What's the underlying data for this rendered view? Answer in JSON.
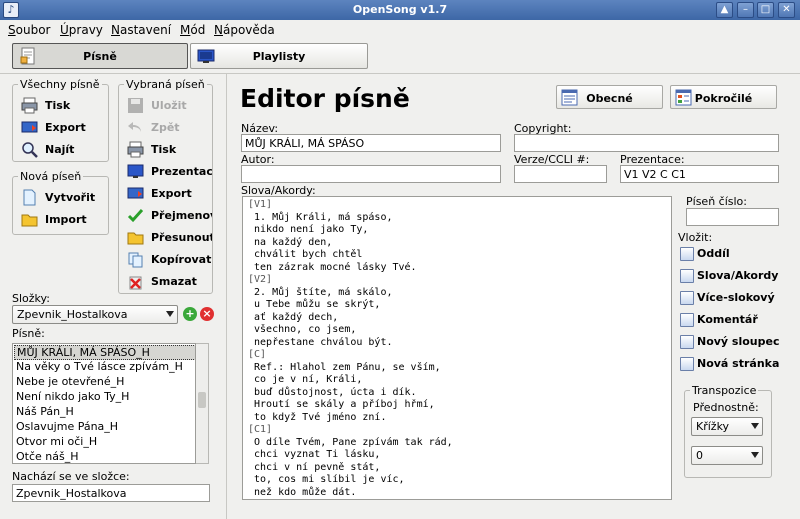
{
  "window": {
    "title": "OpenSong v1.7"
  },
  "menu": [
    "Soubor",
    "Úpravy",
    "Nastavení",
    "Mód",
    "Nápověda"
  ],
  "main_tabs": [
    {
      "label": "Písně",
      "active": true
    },
    {
      "label": "Playlisty",
      "active": false
    }
  ],
  "all_songs": {
    "title": "Všechny písně",
    "buttons": [
      "Tisk",
      "Export",
      "Najít"
    ]
  },
  "new_song": {
    "title": "Nová píseň",
    "buttons": [
      "Vytvořit",
      "Import"
    ]
  },
  "selected_song": {
    "title": "Vybraná píseň",
    "buttons": [
      {
        "label": "Uložit",
        "enabled": false
      },
      {
        "label": "Zpět",
        "enabled": false
      },
      {
        "label": "Tisk",
        "enabled": true
      },
      {
        "label": "Prezentace",
        "enabled": true
      },
      {
        "label": "Export",
        "enabled": true
      },
      {
        "label": "Přejmenovat",
        "enabled": true
      },
      {
        "label": "Přesunout",
        "enabled": true
      },
      {
        "label": "Kopírovat",
        "enabled": true
      },
      {
        "label": "Smazat",
        "enabled": true
      }
    ]
  },
  "folders": {
    "label": "Složky:",
    "value": "Zpevnik_Hostalkova"
  },
  "songs": {
    "label": "Písně:",
    "items": [
      "MŮJ KRÁLI, MÁ SPÁSO_H",
      "Na věky o Tvé lásce zpívám_H",
      "Nebe je otevřené_H",
      "Není nikdo jako Ty_H",
      "Náš Pán_H",
      "Oslavujme Pána_H",
      "Otvor mi oči_H",
      "Otče náš_H"
    ],
    "selected_index": 0
  },
  "in_folder": {
    "label": "Nachází se ve složce:",
    "value": "Zpevnik_Hostalkova"
  },
  "editor": {
    "title": "Editor písně",
    "btn_general": "Obecné",
    "btn_advanced": "Pokročilé",
    "name_label": "Název:",
    "name_value": "MŮJ KRÁLI, MÁ SPÁSO",
    "copyright_label": "Copyright:",
    "copyright_value": "",
    "author_label": "Autor:",
    "author_value": "",
    "ccli_label": "Verze/CCLI #:",
    "ccli_value": "",
    "presentation_label": "Prezentace:",
    "presentation_value": "V1 V2 C C1",
    "lyrics_label": "Slova/Akordy:",
    "lyrics": [
      "[V1]",
      " 1. Můj Králi, má spáso,",
      " nikdo není jako Ty,",
      " na každý den,",
      " chválit bych chtěl",
      " ten zázrak mocné lásky Tvé.",
      "[V2]",
      " 2. Můj štíte, má skálo,",
      " u Tebe můžu se skrýt,",
      " ať každý dech,",
      " všechno, co jsem,",
      " nepřestane chválou být.",
      "[C]",
      " Ref.: Hlahol zem Pánu, se vším,",
      " co je v ní, Králi,",
      " buď důstojnost, úcta i dík.",
      " Hroutí se skály a příboj hřmí,",
      " to když Tvé jméno zní.",
      "[C1]",
      " O díle Tvém, Pane zpívám tak rád,",
      " chci vyznat Ti lásku,",
      " chci v ní pevně stát,",
      " to, cos mi slíbil je víc,",
      " než kdo může dát."
    ],
    "song_number_label": "Píseň číslo:",
    "song_number_value": "",
    "insert_label": "Vložit:",
    "insert_buttons": [
      "Oddíl",
      "Slova/Akordy",
      "Více-slokový",
      "Komentář",
      "Nový sloupec",
      "Nová stránka"
    ]
  },
  "transpose": {
    "title": "Transpozice",
    "preference_label": "Přednostně:",
    "preference_value": "Křížky",
    "amount_value": "0"
  }
}
